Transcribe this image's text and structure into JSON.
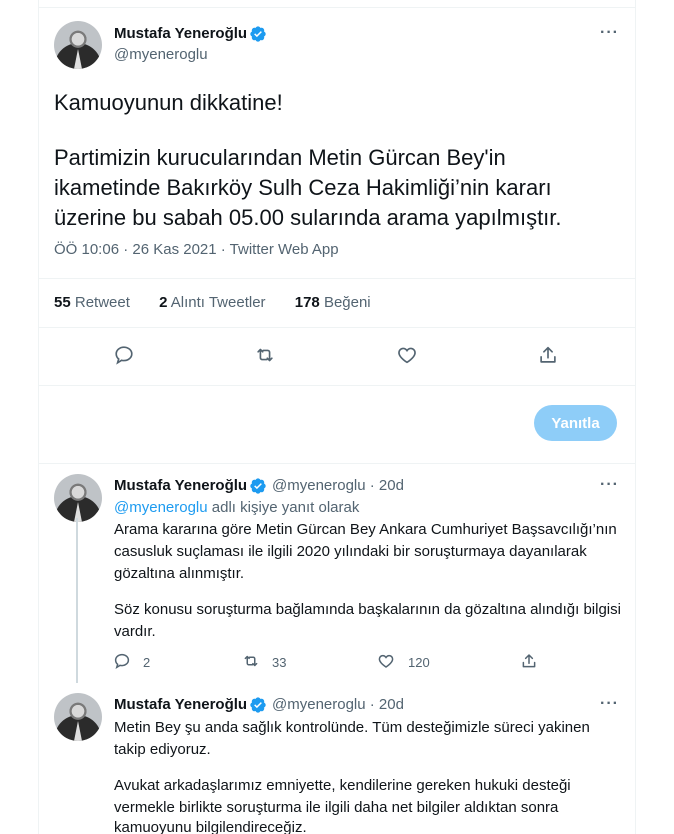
{
  "main_tweet": {
    "author_name": "Mustafa Yeneroğlu",
    "handle": "@myeneroglu",
    "more_label": "···",
    "lines": [
      "Kamuoyunun dikkatine!",
      "",
      "Partimizin kurucularından Metin Gürcan Bey'in",
      "ikametinde Bakırköy Sulh Ceza Hakimliği’nin kararı",
      "üzerine bu sabah 05.00 sularında arama yapılmıştır."
    ],
    "meta": "ÖÖ 10:06 · 26 Kas 2021 · Twitter Web App",
    "stats": {
      "retweets_count": "55",
      "retweets_label": "Retweet",
      "quotes_count": "2",
      "quotes_label": "Alıntı Tweetler",
      "likes_count": "178",
      "likes_label": "Beğeni"
    },
    "reply_button": "Yanıtla"
  },
  "replies": [
    {
      "author_name": "Mustafa Yeneroğlu",
      "handle_time": "@myeneroglu · 20d",
      "reply_to_user": "@myeneroglu",
      "reply_to_suffix": "adlı kişiye yanıt olarak",
      "lines": [
        "Arama kararına göre Metin Gürcan Bey Ankara Cumhuriyet Başsavcılığı’nın",
        "casusluk suçlaması ile ilgili 2020 yılındaki bir soruşturmaya dayanılarak",
        "gözaltına alınmıştır.",
        "",
        "Söz konusu soruşturma bağlamında başkalarının da gözaltına alındığı bilgisi",
        "vardır."
      ],
      "reply_count": "2",
      "retweet_count": "33",
      "like_count": "120"
    },
    {
      "author_name": "Mustafa Yeneroğlu",
      "handle_time": "@myeneroglu · 20d",
      "lines": [
        "Metin Bey şu anda sağlık kontrolünde. Tüm desteğimizle süreci yakinen",
        "takip ediyoruz.",
        "",
        "Avukat arkadaşlarımız emniyette, kendilerine gereken hukuki desteği",
        "vermekle birlikte soruşturma ile ilgili daha net bilgiler aldıktan sonra",
        "kamuoyunu bilgilendireceğiz."
      ]
    }
  ],
  "colors": {
    "accent": "#1d9bf0",
    "reply_button_bg": "#8ecdf8",
    "secondary_text": "#536471"
  }
}
